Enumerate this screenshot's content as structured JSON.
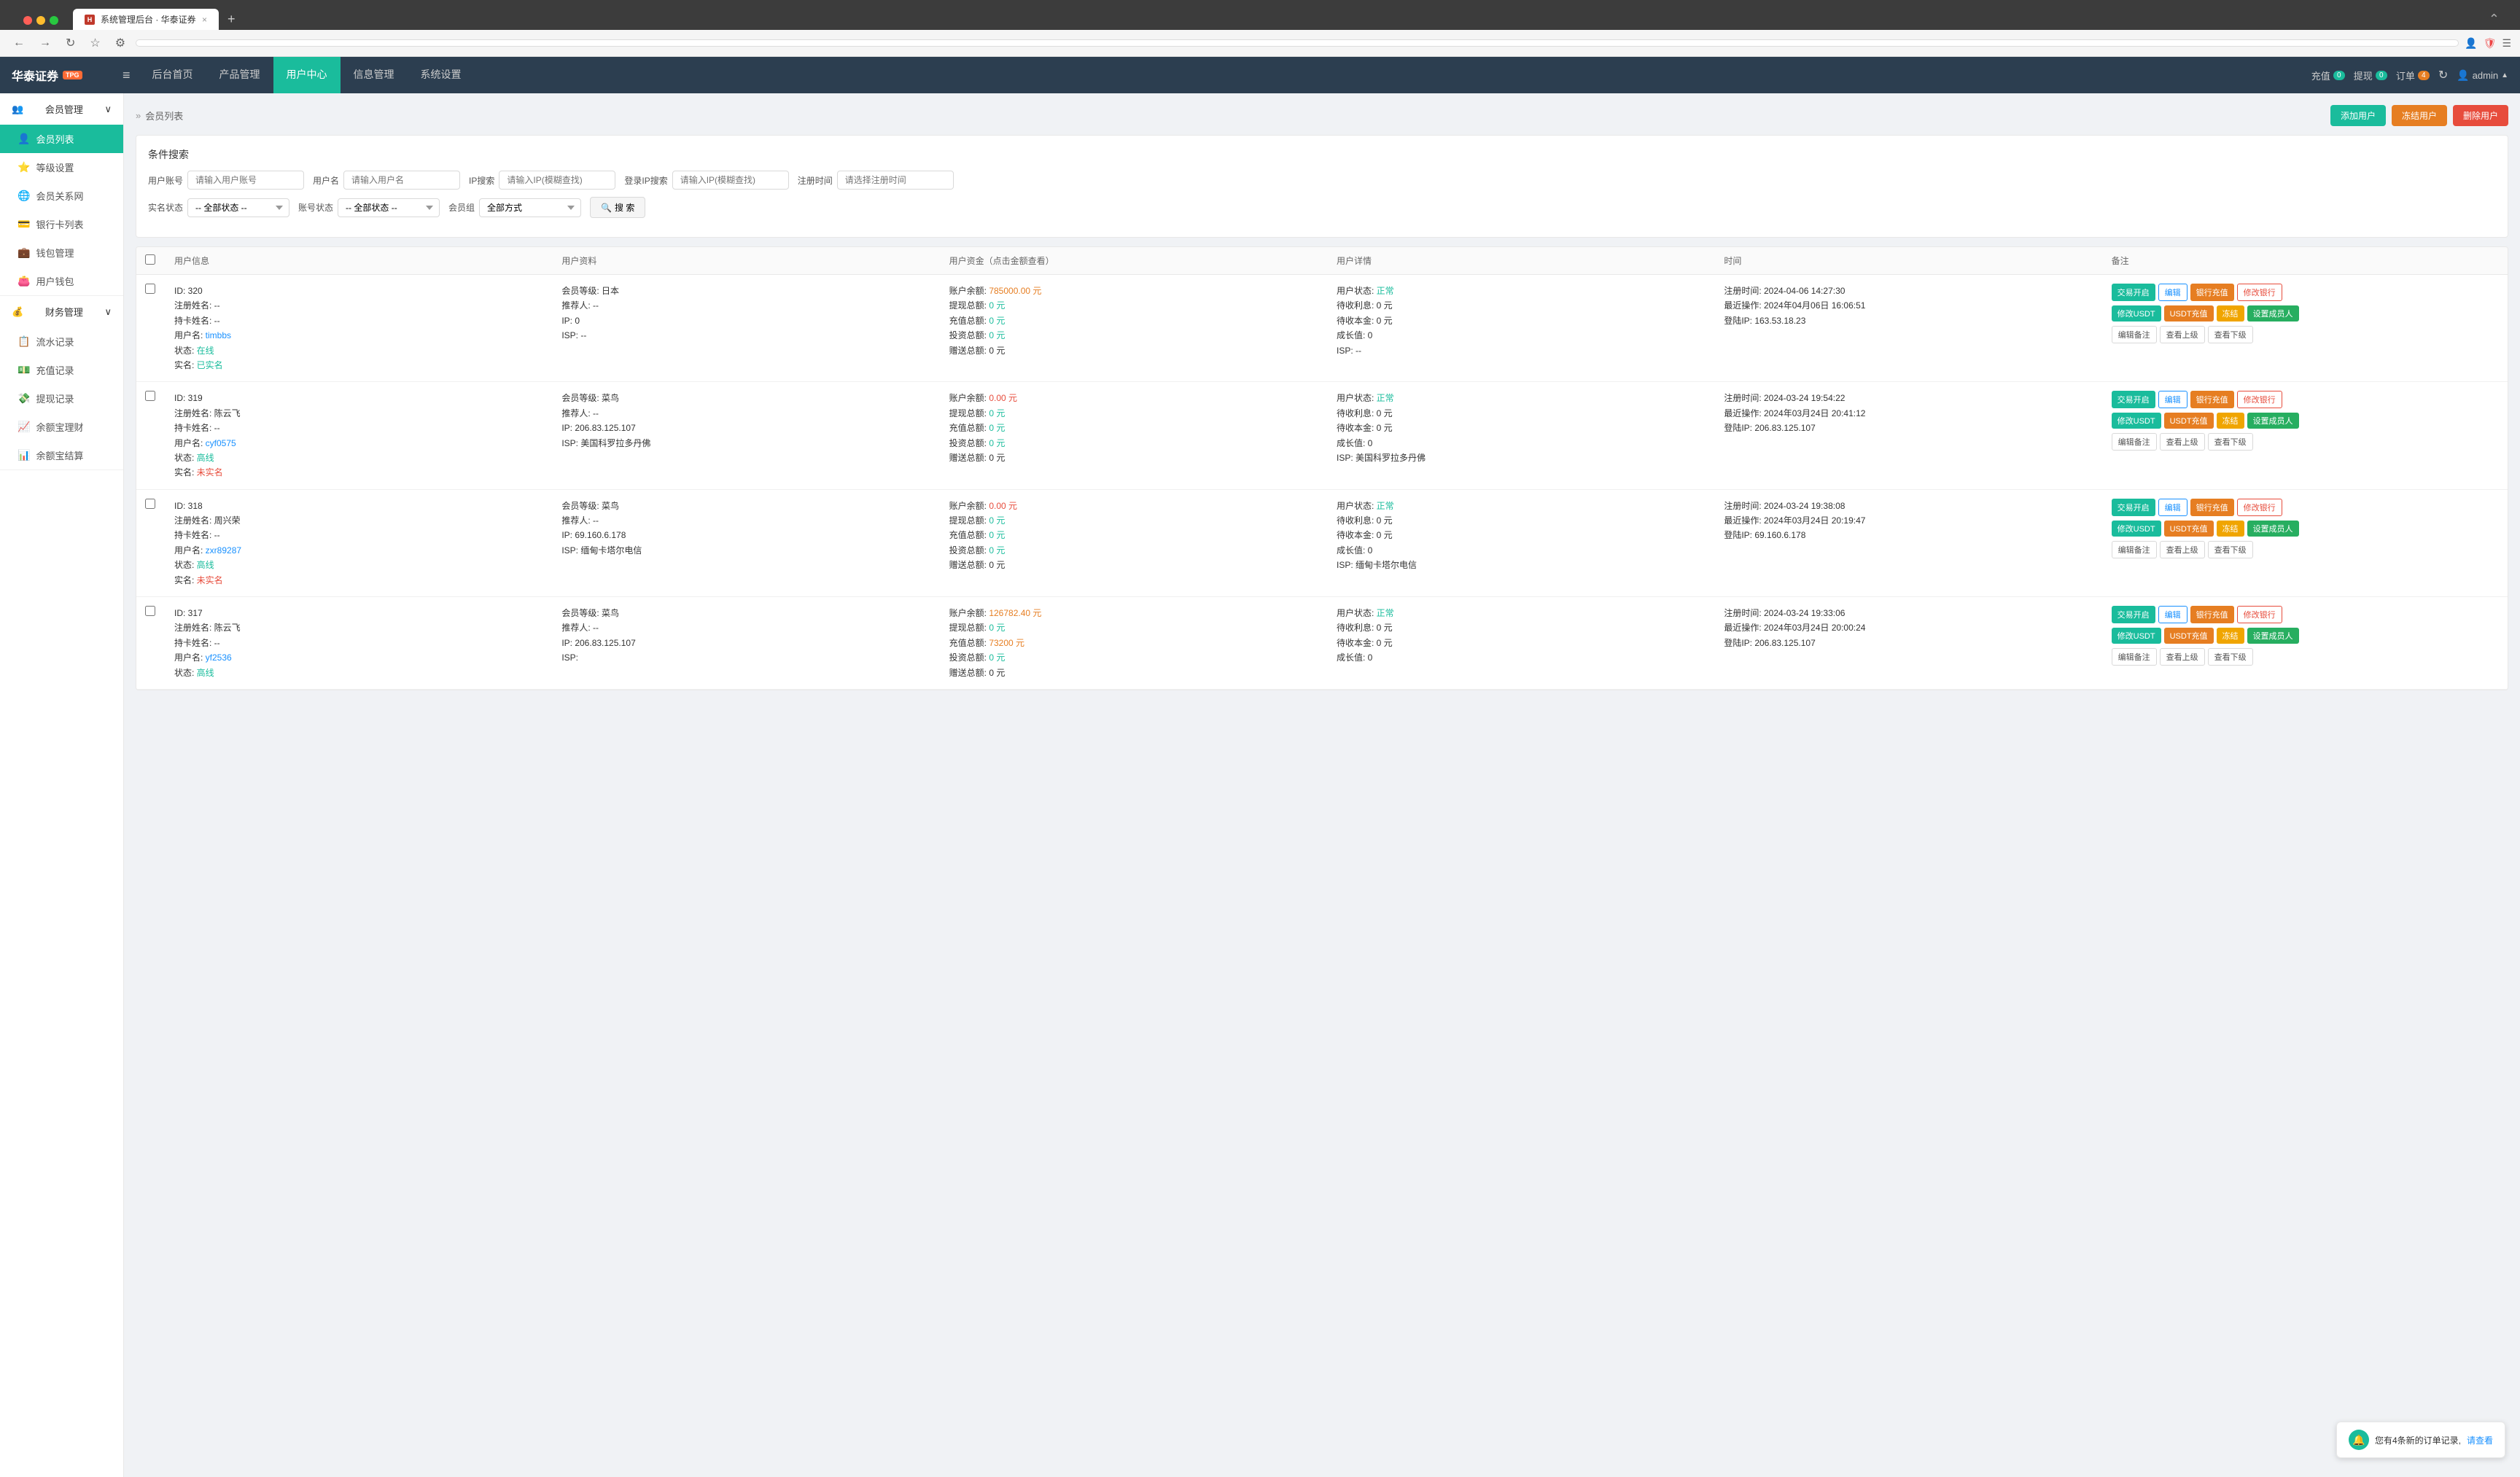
{
  "browser": {
    "tab_title": "系统管理后台 · 华泰证券",
    "favicon": "ht",
    "new_tab_label": "+",
    "back_btn": "←",
    "forward_btn": "→",
    "refresh_btn": "↻",
    "bookmark_btn": "☆",
    "extensions_btn": "⚙",
    "address": "",
    "close_other_tabs": "×"
  },
  "topnav": {
    "logo": "华泰证券",
    "logo_badge": "TPG",
    "toggle_icon": "≡",
    "items": [
      {
        "label": "后台首页",
        "active": false
      },
      {
        "label": "产品管理",
        "active": false
      },
      {
        "label": "用户中心",
        "active": true
      },
      {
        "label": "信息管理",
        "active": false
      },
      {
        "label": "系统设置",
        "active": false
      }
    ],
    "recharge_label": "充值",
    "recharge_badge": "0",
    "withdraw_label": "提现",
    "withdraw_badge": "0",
    "order_label": "订单",
    "order_badge": "4",
    "refresh_icon": "↻",
    "admin_label": "admin",
    "admin_arrow": "▲"
  },
  "sidebar": {
    "sections": [
      {
        "label": "会员管理",
        "icon": "👥",
        "expanded": true,
        "items": [
          {
            "label": "会员列表",
            "icon": "👤",
            "active": true
          },
          {
            "label": "等级设置",
            "icon": "⭐",
            "active": false
          },
          {
            "label": "会员关系网",
            "icon": "🌐",
            "active": false
          },
          {
            "label": "银行卡列表",
            "icon": "💳",
            "active": false
          },
          {
            "label": "钱包管理",
            "icon": "💼",
            "active": false
          },
          {
            "label": "用户钱包",
            "icon": "👛",
            "active": false
          }
        ]
      },
      {
        "label": "财务管理",
        "icon": "💰",
        "expanded": true,
        "items": [
          {
            "label": "流水记录",
            "icon": "📋",
            "active": false
          },
          {
            "label": "充值记录",
            "icon": "💵",
            "active": false
          },
          {
            "label": "提现记录",
            "icon": "💸",
            "active": false
          },
          {
            "label": "余额宝理财",
            "icon": "📈",
            "active": false
          },
          {
            "label": "余额宝结算",
            "icon": "📊",
            "active": false
          }
        ]
      }
    ]
  },
  "breadcrumb": {
    "separator": "»",
    "current": "会员列表"
  },
  "page_header": {
    "title": "会员列表",
    "add_btn": "添加用户",
    "freeze_btn": "冻结用户",
    "delete_btn": "删除用户"
  },
  "search": {
    "title": "条件搜索",
    "account_label": "用户账号",
    "account_placeholder": "请输入用户账号",
    "username_label": "用户名",
    "username_placeholder": "请输入用户名",
    "ip_label": "IP搜索",
    "ip_placeholder": "请输入IP(模糊查找)",
    "login_ip_label": "登录IP搜索",
    "login_ip_placeholder": "请输入IP(模糊查找)",
    "reg_time_label": "注册时间",
    "reg_time_placeholder": "请选择注册时间",
    "realname_label": "实名状态",
    "realname_default": "-- 全部状态 --",
    "account_status_label": "账号状态",
    "account_status_default": "-- 全部状态 --",
    "member_group_label": "会员组",
    "member_group_default": "全部方式",
    "search_btn": "搜 索",
    "search_icon": "🔍"
  },
  "table": {
    "columns": [
      "",
      "用户信息",
      "用户资料",
      "用户资金（点击金额查看）",
      "用户详情",
      "时间",
      "备注"
    ],
    "rows": [
      {
        "id": "320",
        "reg_name": "--",
        "card_holder": "--",
        "username": "timbbs",
        "status": "在线",
        "realname_status": "已实名",
        "member_level": "日本",
        "referrer": "--",
        "ip": "0",
        "isp": "--",
        "balance": "785000.00 元",
        "withdraw_total": "0 元",
        "recharge_total": "0 元",
        "invest_total": "0 元",
        "gift_total": "0 元",
        "user_status": "正常",
        "pending_income": "0 元",
        "pending_capital": "0 元",
        "growth": "0",
        "reg_time": "2024-04-06 14:27:30",
        "last_op": "2024年04月06日 16:06:51",
        "login_ip": "163.53.18.23",
        "isp2": "--",
        "actions": {
          "row1": [
            "交易开启",
            "编辑",
            "银行充值",
            "修改银行"
          ],
          "row2": [
            "修改USDT",
            "USDT充值",
            "冻结",
            "设置成员人"
          ],
          "row3": [
            "编辑备注",
            "查看上级",
            "查看下级"
          ]
        }
      },
      {
        "id": "319",
        "reg_name": "陈云飞",
        "card_holder": "--",
        "username": "cyf0575",
        "status": "高线",
        "realname_status": "未实名",
        "member_level": "菜鸟",
        "referrer": "--",
        "ip": "206.83.125.107",
        "isp": "美国科罗拉多丹佛",
        "balance": "0.00 元",
        "withdraw_total": "0 元",
        "recharge_total": "0 元",
        "invest_total": "0 元",
        "gift_total": "0 元",
        "user_status": "正常",
        "pending_income": "0 元",
        "pending_capital": "0 元",
        "growth": "0",
        "reg_time": "2024-03-24 19:54:22",
        "last_op": "2024年03月24日 20:41:12",
        "login_ip": "206.83.125.107",
        "isp2": "美国科罗拉多丹佛",
        "actions": {
          "row1": [
            "交易开启",
            "编辑",
            "银行充值",
            "修改银行"
          ],
          "row2": [
            "修改USDT",
            "USDT充值",
            "冻结",
            "设置成员人"
          ],
          "row3": [
            "编辑备注",
            "查看上级",
            "查看下级"
          ]
        }
      },
      {
        "id": "318",
        "reg_name": "周兴荣",
        "card_holder": "--",
        "username": "zxr89287",
        "status": "高线",
        "realname_status": "未实名",
        "member_level": "菜鸟",
        "referrer": "--",
        "ip": "69.160.6.178",
        "isp": "缅甸卡塔尔电信",
        "balance": "0.00 元",
        "withdraw_total": "0 元",
        "recharge_total": "0 元",
        "invest_total": "0 元",
        "gift_total": "0 元",
        "user_status": "正常",
        "pending_income": "0 元",
        "pending_capital": "0 元",
        "growth": "0",
        "reg_time": "2024-03-24 19:38:08",
        "last_op": "2024年03月24日 20:19:47",
        "login_ip": "69.160.6.178",
        "isp2": "缅甸卡塔尔电信",
        "actions": {
          "row1": [
            "交易开启",
            "编辑",
            "银行充值",
            "修改银行"
          ],
          "row2": [
            "修改USDT",
            "USDT充值",
            "冻结",
            "设置成员人"
          ],
          "row3": [
            "编辑备注",
            "查看上级",
            "查看下级"
          ]
        }
      },
      {
        "id": "317",
        "reg_name": "陈云飞",
        "card_holder": "--",
        "username": "yf2536",
        "status": "高线",
        "realname_status": "",
        "member_level": "菜鸟",
        "referrer": "--",
        "ip": "206.83.125.107",
        "isp": "",
        "balance": "126782.40 元",
        "withdraw_total": "0 元",
        "recharge_total": "73200 元",
        "invest_total": "0 元",
        "gift_total": "0 元",
        "user_status": "正常",
        "pending_income": "0 元",
        "pending_capital": "0 元",
        "growth": "0",
        "reg_time": "2024-03-24 19:33:06",
        "last_op": "2024年03月24日 20:00:24",
        "login_ip": "206.83.125.107",
        "isp2": "",
        "actions": {
          "row1": [
            "交易开启",
            "编辑",
            "银行充值",
            "修改银行"
          ],
          "row2": [
            "修改USDT",
            "USDT充值",
            "冻结",
            "设置成员人"
          ],
          "row3": [
            "编辑备注",
            "查看上级",
            "查看下级"
          ]
        }
      }
    ]
  },
  "notification": {
    "text": "您有4条新的订单记录,",
    "link_text": "请查看",
    "icon": "🔔"
  }
}
